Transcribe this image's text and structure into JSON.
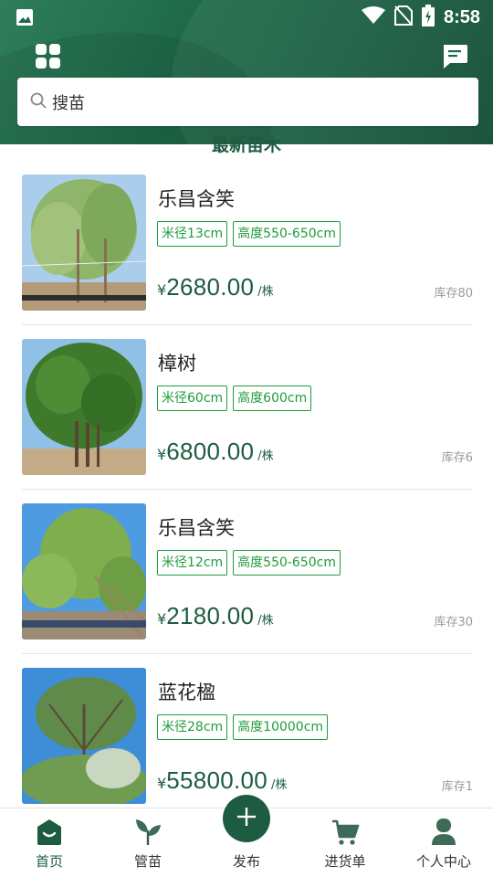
{
  "status_bar": {
    "time": "8:58"
  },
  "search": {
    "placeholder": "搜苗"
  },
  "section": {
    "title": "最新苗木"
  },
  "products": [
    {
      "name": "乐昌含笑",
      "tags": [
        "米径13cm",
        "高度550-650cm"
      ],
      "currency": "¥",
      "price": "2680.00",
      "unit": "/株",
      "stock": "库存80"
    },
    {
      "name": "樟树",
      "tags": [
        "米径60cm",
        "高度600cm"
      ],
      "currency": "¥",
      "price": "6800.00",
      "unit": "/株",
      "stock": "库存6"
    },
    {
      "name": "乐昌含笑",
      "tags": [
        "米径12cm",
        "高度550-650cm"
      ],
      "currency": "¥",
      "price": "2180.00",
      "unit": "/株",
      "stock": "库存30"
    },
    {
      "name": "蓝花楹",
      "tags": [
        "米径28cm",
        "高度10000cm"
      ],
      "currency": "¥",
      "price": "55800.00",
      "unit": "/株",
      "stock": "库存1"
    }
  ],
  "nav": {
    "home": "首页",
    "nursery": "管苗",
    "publish": "发布",
    "orders": "进货单",
    "profile": "个人中心"
  },
  "colors": {
    "brand": "#1d5c40",
    "tag": "#1e9d3c"
  }
}
